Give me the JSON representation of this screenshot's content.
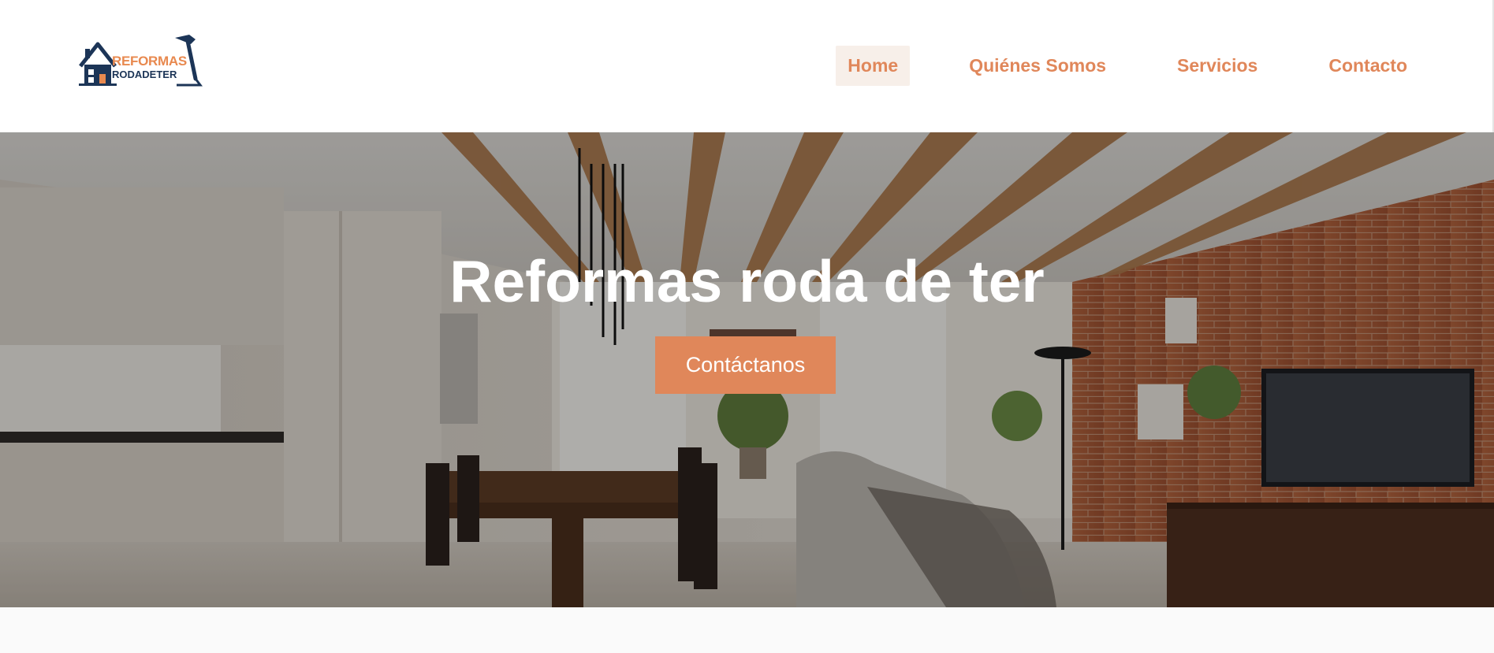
{
  "brand": {
    "line1": "REFORMAS",
    "line2": "RODADETER",
    "logo_icon": "house-hammer-icon",
    "colors": {
      "orange": "#e8894f",
      "navy": "#1c3557"
    }
  },
  "nav": {
    "items": [
      {
        "label": "Home",
        "active": true
      },
      {
        "label": "Quiénes Somos",
        "active": false
      },
      {
        "label": "Servicios",
        "active": false
      },
      {
        "label": "Contacto",
        "active": false
      }
    ],
    "accent": "#e0875a",
    "active_bg": "#f7efe9"
  },
  "hero": {
    "title": "Reformas roda de ter",
    "cta_label": "Contáctanos",
    "image": "modern-open-kitchen-living-room-photo"
  }
}
